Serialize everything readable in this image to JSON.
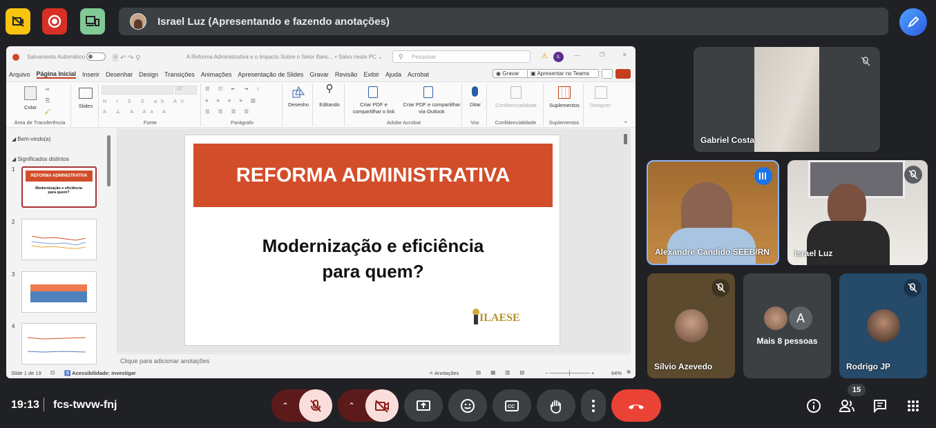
{
  "meeting": {
    "presenter_banner": "Israel Luz (Apresentando e fazendo anotações)",
    "time": "19:13",
    "code": "fcs-twvw-fnj",
    "participant_count": "15"
  },
  "ppt": {
    "autosave_label": "Salvamento Automático",
    "doc_title": "A Reforma Administrativa e o Impacto Sobre o Setor Banc... • Salvo neste PC ⌄",
    "search_placeholder": "Pesquisar",
    "user_initials": "IL",
    "menu": [
      "Arquivo",
      "Página Inicial",
      "Inserir",
      "Desenhar",
      "Design",
      "Transições",
      "Animações",
      "Apresentação de Slides",
      "Gravar",
      "Revisão",
      "Exibir",
      "Ajuda",
      "Acrobat"
    ],
    "record_label": "Gravar",
    "teams_label": "Apresentar no Teams",
    "ribbon": {
      "paste": "Colar",
      "clipboard_group": "Área de Transferência",
      "slides": "Slides",
      "font_group": "Fonte",
      "font_size": "22",
      "paragraph_group": "Parágrafo",
      "drawing": "Desenho",
      "editing": "Editando",
      "create_pdf_link": "Criar PDF e compartilhar o link",
      "create_pdf_outlook": "Criar PDF e compartilhar via Outlook",
      "acrobat_group": "Adobe Acrobat",
      "dictate": "Ditar",
      "voice_group": "Voz",
      "sensitivity": "Confidencialidade",
      "sensitivity_group": "Confidencialidade",
      "addins": "Suplementos",
      "addins_group": "Suplementos",
      "designer": "Designer"
    },
    "sections": [
      "Bem-vindo(a)",
      "Significados distintos"
    ],
    "thumb_numbers": [
      "1",
      "2",
      "3",
      "4"
    ],
    "thumb1_title": "REFORMA ADMINISTRATIVA",
    "thumb1_sub": "Modernização e eficiência para quem?",
    "slide_title": "REFORMA ADMINISTRATIVA",
    "slide_sub_line1": "Modernização e eficiência",
    "slide_sub_line2": "para quem?",
    "logo_text": "ILAESE",
    "notes_placeholder": "Clique para adicionar anotações",
    "status_slide": "Slide 1 de 19",
    "status_access": "Acessibilidade: investigar",
    "status_notes": "Anotações",
    "zoom": "64%"
  },
  "participants": [
    {
      "name": "Gabriel Costa"
    },
    {
      "name": "Alexandre Candido SEEB/RN"
    },
    {
      "name": "Israel Luz"
    },
    {
      "name": "Sílvio Azevedo"
    },
    {
      "name": "Mais 8 pessoas",
      "initial": "A"
    },
    {
      "name": "Rodrigo JP"
    }
  ],
  "colors": {
    "end_call": "#ea4335",
    "muted_btn": "#f9dedc",
    "accent_slide": "#d24e2a"
  }
}
